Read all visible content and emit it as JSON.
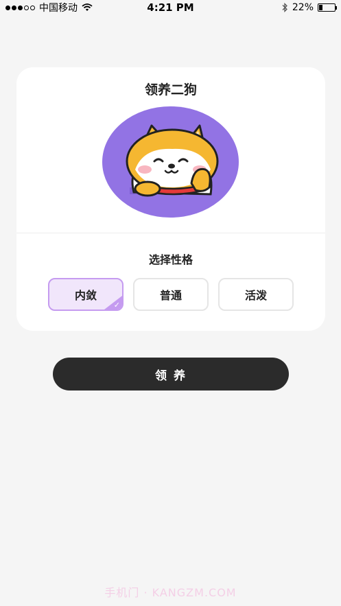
{
  "status_bar": {
    "carrier": "中国移动",
    "time": "4:21 PM",
    "battery": "22%",
    "battery_level": 0.22,
    "signal_bars_filled": 3,
    "signal_bars_total": 5,
    "icons": [
      "signal-icon",
      "wifi-icon",
      "bluetooth-icon",
      "battery-icon"
    ]
  },
  "card": {
    "title": "领养二狗",
    "avatar_bg": "#9273e4",
    "section_label": "选择性格",
    "options": [
      {
        "label": "内敛",
        "selected": true
      },
      {
        "label": "普通",
        "selected": false
      },
      {
        "label": "活泼",
        "selected": false
      }
    ],
    "accent": "#c59bf0"
  },
  "adopt_button": {
    "label": "领 养",
    "color": "#2b2b2b"
  },
  "watermark": "手机门 · KANGZM.COM"
}
